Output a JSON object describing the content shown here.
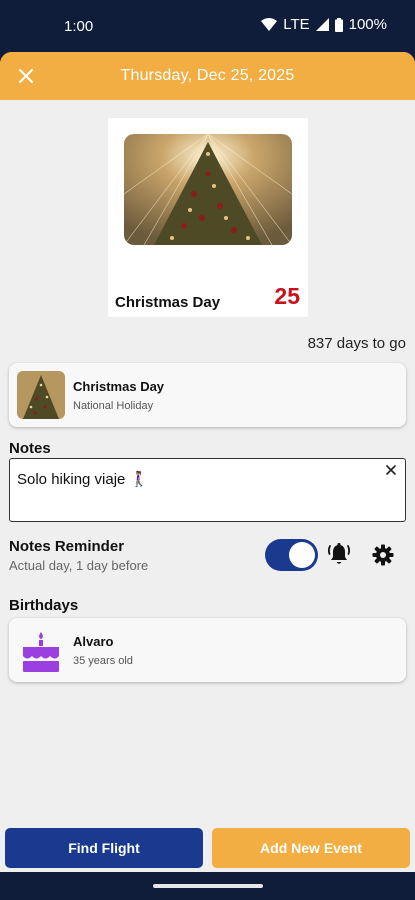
{
  "status_bar": {
    "time": "1:00",
    "network": "LTE",
    "battery": "100%"
  },
  "app_bar": {
    "title": "Thursday, Dec 25, 2025",
    "close_icon": "close-icon",
    "color": "#f2ae42"
  },
  "hero": {
    "label": "Christmas Day",
    "day": "25",
    "day_color": "#c8111b",
    "image": "christmas-tree-lights"
  },
  "countdown": "837 days to go",
  "holiday": {
    "title": "Christmas Day",
    "subtitle": "National Holiday"
  },
  "notes": {
    "label": "Notes",
    "value": "Solo hiking viaje 🚶🏽‍♀️",
    "clear_icon": "close-icon"
  },
  "reminder": {
    "title": "Notes Reminder",
    "subtitle": "Actual day, 1 day before",
    "enabled": true,
    "bell_icon": "bell-ring-icon",
    "settings_icon": "gear-icon"
  },
  "birthdays": {
    "label": "Birthdays",
    "items": [
      {
        "name": "Alvaro",
        "detail": "35 years old",
        "icon": "cake-icon"
      }
    ]
  },
  "actions": {
    "find_flight": "Find Flight",
    "add_event": "Add New Event",
    "primary_color": "#1a3a8f",
    "secondary_color": "#f2ae42"
  }
}
